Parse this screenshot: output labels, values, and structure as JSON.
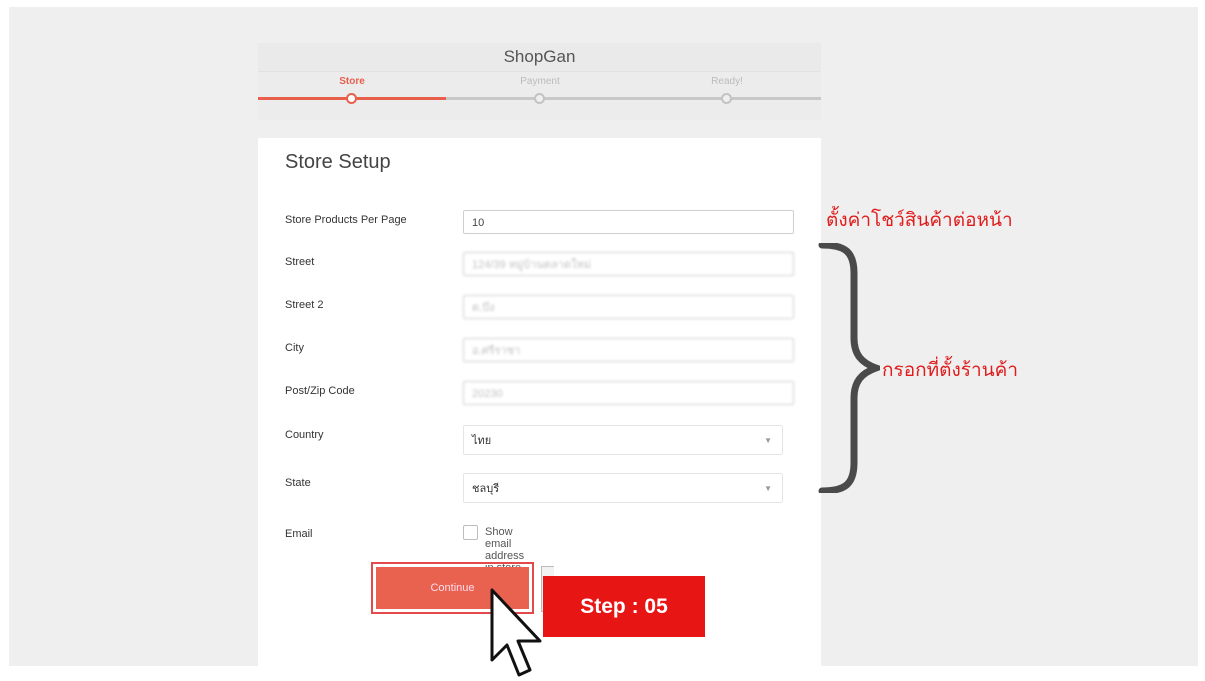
{
  "app": {
    "brand": "ShopGan"
  },
  "steps": [
    {
      "label": "Store",
      "active": true
    },
    {
      "label": "Payment",
      "active": false
    },
    {
      "label": "Ready!",
      "active": false
    }
  ],
  "form": {
    "title": "Store Setup",
    "fields": {
      "products_per_page": {
        "label": "Store Products Per Page",
        "value": "10"
      },
      "street": {
        "label": "Street",
        "value": "124/39 หมู่บ้านตลาดใหม่"
      },
      "street2": {
        "label": "Street 2",
        "value": "ต.บึง"
      },
      "city": {
        "label": "City",
        "value": "อ.ศรีราชา"
      },
      "postcode": {
        "label": "Post/Zip Code",
        "value": "20230"
      },
      "country": {
        "label": "Country",
        "value": "ไทย"
      },
      "state": {
        "label": "State",
        "value": "ชลบุรี"
      },
      "email": {
        "label": "Email",
        "checkbox_label": "Show email address in store",
        "checked": false
      }
    },
    "continue_label": "Continue"
  },
  "annotations": {
    "products_note": "ตั้งค่าโชว์สินค้าต่อหน้า",
    "address_note": "กรอกที่ตั้งร้านค้า",
    "step_badge": "Step : 05"
  },
  "colors": {
    "accent": "#e8604c",
    "annotation_red": "#e01d1d",
    "badge_red": "#e81515"
  }
}
